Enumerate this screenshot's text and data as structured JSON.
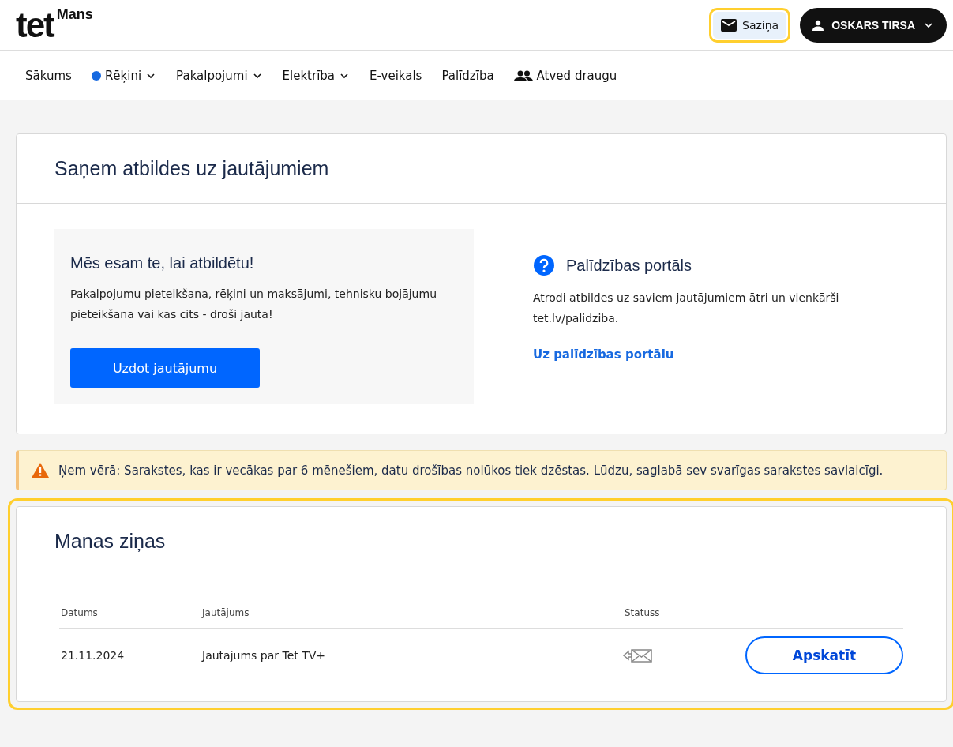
{
  "header": {
    "logo": "tet",
    "logo_sub": "Mans",
    "contact_button": {
      "label": "Saziņa",
      "highlighted": true
    },
    "user_button": {
      "label": "OSKARS TIRSA"
    }
  },
  "nav": [
    {
      "label": "Sākums",
      "dot": false,
      "dropdown": false,
      "kind": "plain"
    },
    {
      "label": "Rēķini",
      "dot": true,
      "dropdown": true,
      "kind": "plain"
    },
    {
      "label": "Pakalpojumi",
      "dot": false,
      "dropdown": true,
      "kind": "plain"
    },
    {
      "label": "Elektrība",
      "dot": false,
      "dropdown": true,
      "kind": "plain"
    },
    {
      "label": "E-veikals",
      "dot": false,
      "dropdown": false,
      "kind": "plain"
    },
    {
      "label": "Palīdzība",
      "dot": false,
      "dropdown": false,
      "kind": "plain"
    },
    {
      "label": "Atved draugu",
      "dot": false,
      "dropdown": false,
      "kind": "people"
    }
  ],
  "answers_card": {
    "title": "Saņem atbildes uz jautājumiem",
    "ask_panel": {
      "title": "Mēs esam te, lai atbildētu!",
      "text": "Pakalpojumu pieteikšana, rēķini un maksājumi, tehnisku bojājumu pieteikšana vai kas cits - droši jautā!",
      "button": "Uzdot jautājumu"
    },
    "help_panel": {
      "title": "Palīdzības portāls",
      "text": "Atrodi atbildes uz saviem jautājumiem ātri un vienkārši tet.lv/palidziba.",
      "link": "Uz palīdzības portālu"
    }
  },
  "notice": "Ņem vērā: Sarakstes, kas ir vecākas par 6 mēnešiem, datu drošības nolūkos tiek dzēstas. Lūdzu, saglabā sev svarīgas sarakstes savlaicīgi.",
  "messages": {
    "title": "Manas ziņas",
    "highlighted": true,
    "columns": [
      "Datums",
      "Jautājums",
      "Statuss"
    ],
    "rows": [
      {
        "date": "21.11.2024",
        "question": "Jautājums par Tet TV+",
        "kind": "replied",
        "button": "Apskatīt"
      }
    ]
  }
}
